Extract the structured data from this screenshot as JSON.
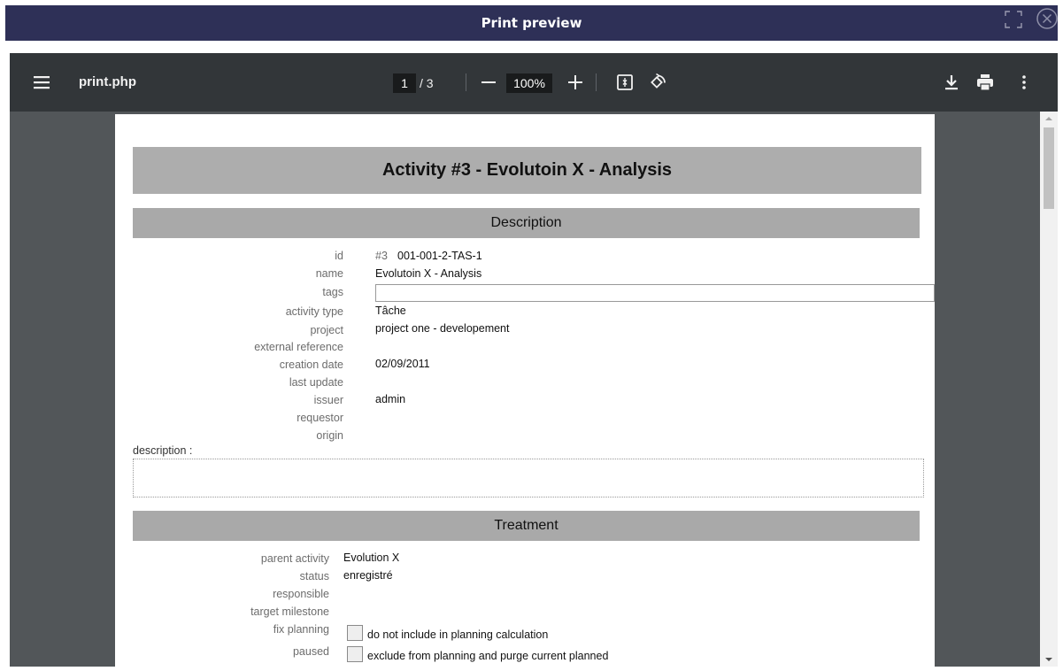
{
  "dialog": {
    "title": "Print preview",
    "maximize_icon": "maximize-icon",
    "close_icon": "close-circle-icon"
  },
  "toolbar": {
    "filename": "print.php",
    "page_current": "1",
    "page_total": "/ 3",
    "zoom": "100%",
    "icons": [
      "menu-icon",
      "zoom-out-icon",
      "zoom-in-icon",
      "fit-page-icon",
      "rotate-icon",
      "download-icon",
      "print-icon",
      "more-options-icon"
    ]
  },
  "document": {
    "title": "Activity #3 - Evolutoin X - Analysis",
    "description_section": {
      "heading": "Description",
      "fields": [
        {
          "label": "id",
          "prefix": "#3",
          "value": "001-001-2-TAS-1"
        },
        {
          "label": "name",
          "value": "Evolutoin X - Analysis"
        },
        {
          "label": "tags",
          "value": ""
        },
        {
          "label": "activity type",
          "value": "Tâche"
        },
        {
          "label": "project",
          "value": "project one - developement"
        },
        {
          "label": "external reference",
          "value": ""
        },
        {
          "label": "creation date",
          "value": "02/09/2011"
        },
        {
          "label": "last update",
          "value": ""
        },
        {
          "label": "issuer",
          "value": "admin"
        },
        {
          "label": "requestor",
          "value": ""
        },
        {
          "label": "origin",
          "value": ""
        }
      ],
      "description_label": "description :"
    },
    "treatment_section": {
      "heading": "Treatment",
      "fields": [
        {
          "label": "parent activity",
          "value": "Evolution X"
        },
        {
          "label": "status",
          "value": "enregistré"
        },
        {
          "label": "responsible",
          "value": ""
        },
        {
          "label": "target milestone",
          "value": ""
        },
        {
          "label": "fix planning",
          "value": "do not include in planning calculation",
          "checked": false
        },
        {
          "label": "paused",
          "value": "exclude from planning and purge current planned",
          "checked": false
        }
      ]
    }
  }
}
